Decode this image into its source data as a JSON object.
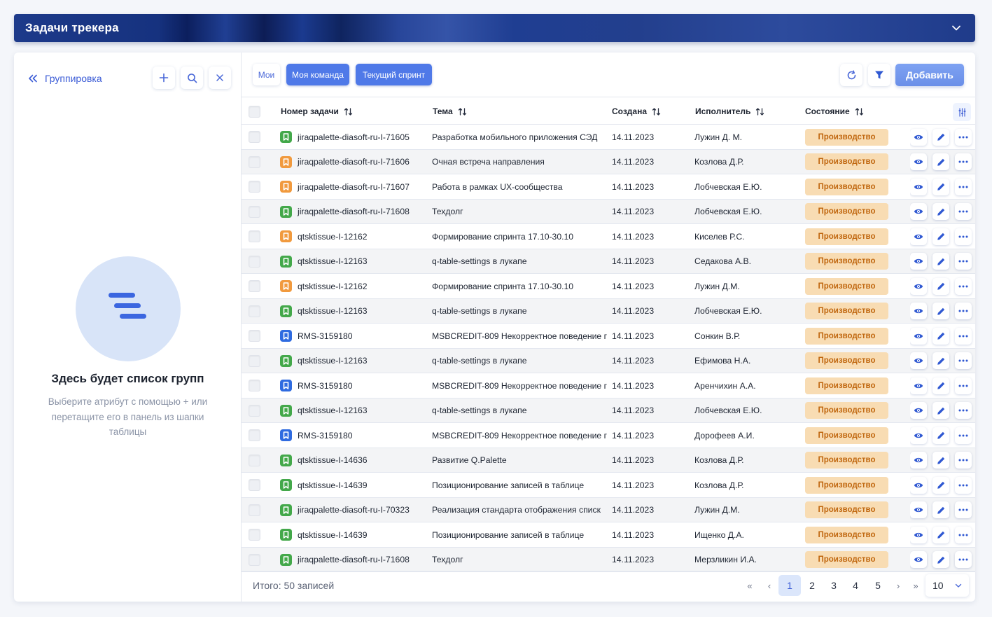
{
  "header": {
    "title": "Задачи трекера"
  },
  "grouping": {
    "label": "Группировка",
    "empty_title": "Здесь будет список групп",
    "empty_description": "Выберите атрибут с помощью + или перетащите его в панель из шапки таблицы"
  },
  "toolbar": {
    "filters": [
      "Мои",
      "Моя команда",
      "Текущий спринт"
    ],
    "active_filters": [
      "Моя команда",
      "Текущий спринт"
    ],
    "add_label": "Добавить"
  },
  "table": {
    "columns": [
      "Номер задачи",
      "Тема",
      "Создана",
      "Исполнитель",
      "Состояние"
    ],
    "rows": [
      {
        "num": "jiraqpalette-diasoft-ru-I-71605",
        "tag": "green",
        "theme": "Разработка мобильного приложения СЭД",
        "date": "14.11.2023",
        "user": "Лужин Д. М.",
        "state": "Производство"
      },
      {
        "num": "jiraqpalette-diasoft-ru-I-71606",
        "tag": "orange",
        "theme": "Очная встреча направления",
        "date": "14.11.2023",
        "user": "Козлова Д.Р.",
        "state": "Производство"
      },
      {
        "num": "jiraqpalette-diasoft-ru-I-71607",
        "tag": "orange",
        "theme": "Работа в рамках UX-сообщества",
        "date": "14.11.2023",
        "user": "Лобчевская Е.Ю.",
        "state": "Производство"
      },
      {
        "num": "jiraqpalette-diasoft-ru-I-71608",
        "tag": "green",
        "theme": "Техдолг",
        "date": "14.11.2023",
        "user": "Лобчевская Е.Ю.",
        "state": "Производство"
      },
      {
        "num": "qtsktissue-I-12162",
        "tag": "orange",
        "theme": "Формирование спринта 17.10-30.10",
        "date": "14.11.2023",
        "user": "Киселев Р.С.",
        "state": "Производство"
      },
      {
        "num": "qtsktissue-I-12163",
        "tag": "green",
        "theme": "q-table-settings в лукапе",
        "date": "14.11.2023",
        "user": "Седакова А.В.",
        "state": "Производство"
      },
      {
        "num": "qtsktissue-I-12162",
        "tag": "orange",
        "theme": "Формирование спринта 17.10-30.10",
        "date": "14.11.2023",
        "user": "Лужин Д.М.",
        "state": "Производство"
      },
      {
        "num": "qtsktissue-I-12163",
        "tag": "green",
        "theme": "q-table-settings в лукапе",
        "date": "14.11.2023",
        "user": "Лобчевская Е.Ю.",
        "state": "Производство"
      },
      {
        "num": "RMS-3159180",
        "tag": "blue",
        "theme": "MSBCREDIT-809 Некорректное поведение г",
        "date": "14.11.2023",
        "user": "Сонкин В.Р.",
        "state": "Производство"
      },
      {
        "num": "qtsktissue-I-12163",
        "tag": "green",
        "theme": "q-table-settings в лукапе",
        "date": "14.11.2023",
        "user": "Ефимова Н.А.",
        "state": "Производство"
      },
      {
        "num": "RMS-3159180",
        "tag": "blue",
        "theme": "MSBCREDIT-809 Некорректное поведение г",
        "date": "14.11.2023",
        "user": "Аренчихин А.А.",
        "state": "Производство"
      },
      {
        "num": "qtsktissue-I-12163",
        "tag": "green",
        "theme": "q-table-settings в лукапе",
        "date": "14.11.2023",
        "user": "Лобчевская Е.Ю.",
        "state": "Производство"
      },
      {
        "num": "RMS-3159180",
        "tag": "blue",
        "theme": "MSBCREDIT-809 Некорректное поведение г",
        "date": "14.11.2023",
        "user": "Дорофеев А.И.",
        "state": "Производство"
      },
      {
        "num": "qtsktissue-I-14636",
        "tag": "green",
        "theme": "Развитие Q.Palette",
        "date": "14.11.2023",
        "user": "Козлова Д.Р.",
        "state": "Производство"
      },
      {
        "num": "qtsktissue-I-14639",
        "tag": "green",
        "theme": "Позиционирование записей в таблице",
        "date": "14.11.2023",
        "user": "Козлова Д.Р.",
        "state": "Производство"
      },
      {
        "num": "jiraqpalette-diasoft-ru-I-70323",
        "tag": "green",
        "theme": "Реализация стандарта отображения списк",
        "date": "14.11.2023",
        "user": "Лужин Д.М.",
        "state": "Производство"
      },
      {
        "num": "qtsktissue-I-14639",
        "tag": "green",
        "theme": "Позиционирование записей в таблице",
        "date": "14.11.2023",
        "user": "Ищенко Д.А.",
        "state": "Производство"
      },
      {
        "num": "jiraqpalette-diasoft-ru-I-71608",
        "tag": "green",
        "theme": "Техдолг",
        "date": "14.11.2023",
        "user": "Мерзликин И.А.",
        "state": "Производство"
      }
    ]
  },
  "footer": {
    "total": "Итого: 50 записей",
    "nav_first": "«",
    "nav_prev": "‹",
    "pages": [
      "1",
      "2",
      "3",
      "4",
      "5"
    ],
    "current_page": "1",
    "nav_next": "›",
    "nav_last": "»",
    "per_page": "10"
  },
  "colors": {
    "accent": "#3a5bd6",
    "tag_green": "#43a84a",
    "tag_orange": "#f19a3e",
    "tag_blue": "#2f6be0",
    "badge_bg": "#f8dcb3",
    "badge_text": "#c0670f"
  },
  "icons": {
    "collapse": "chevron-down-icon",
    "back": "double-chevron-left-icon",
    "add": "plus-icon",
    "search": "search-icon",
    "clear": "close-icon",
    "refresh": "refresh-icon",
    "filter": "filter-icon",
    "sort": "sort-icon",
    "settings": "column-settings-icon",
    "view": "eye-icon",
    "edit": "pencil-icon",
    "more": "more-icon"
  }
}
